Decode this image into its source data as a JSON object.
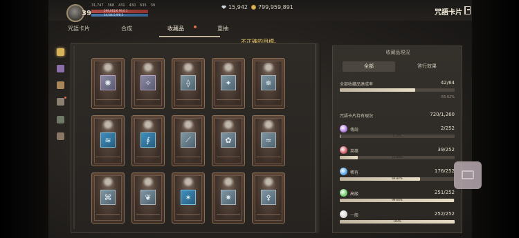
{
  "header": {
    "level": "39",
    "stats": [
      "31,747",
      "368",
      "431",
      "430",
      "635",
      "39"
    ],
    "hp_text": "599,061/6 99,0 1",
    "mp_text": "14,5/4,5,9/8,5",
    "gems": "15,942",
    "gold": "799,959,891",
    "page_title": "咒語卡片"
  },
  "tabs": [
    "咒語卡片",
    "合成",
    "收藏品",
    "重抽"
  ],
  "hint": "不正確的目標。",
  "cards": {
    "rows": [
      [
        "✺",
        "✧",
        "⟠",
        "✦",
        "✵"
      ],
      [
        "≋",
        "∮",
        "⟋",
        "✿",
        "≈"
      ],
      [
        "⌘",
        "❦",
        "✶",
        "✷",
        "⚴"
      ]
    ]
  },
  "panel": {
    "title": "收藏品現況",
    "seg_all": "全部",
    "seg_effect": "答行效果",
    "overall_label": "全部收藏品達成率",
    "overall_value": "42/64",
    "overall_pct": "65.62%",
    "holdings_label": "咒語卡片持有現況",
    "holdings_value": "720/1,260",
    "rarities": [
      {
        "name": "傳說",
        "value": "2/252",
        "pct": "0.79%",
        "fraction": 0.0079,
        "color": "#b27be0"
      },
      {
        "name": "英雄",
        "value": "39/252",
        "pct": "15.48%",
        "fraction": 0.1548,
        "color": "#d05d68"
      },
      {
        "name": "稀有",
        "value": "176/252",
        "pct": "69.84%",
        "fraction": 0.6984,
        "color": "#5aa6e8"
      },
      {
        "name": "高級",
        "value": "251/252",
        "pct": "99.60%",
        "fraction": 0.996,
        "color": "#6fcf6a"
      },
      {
        "name": "一般",
        "value": "252/252",
        "pct": "100%",
        "fraction": 1.0,
        "color": "#d8d8d8"
      }
    ]
  }
}
